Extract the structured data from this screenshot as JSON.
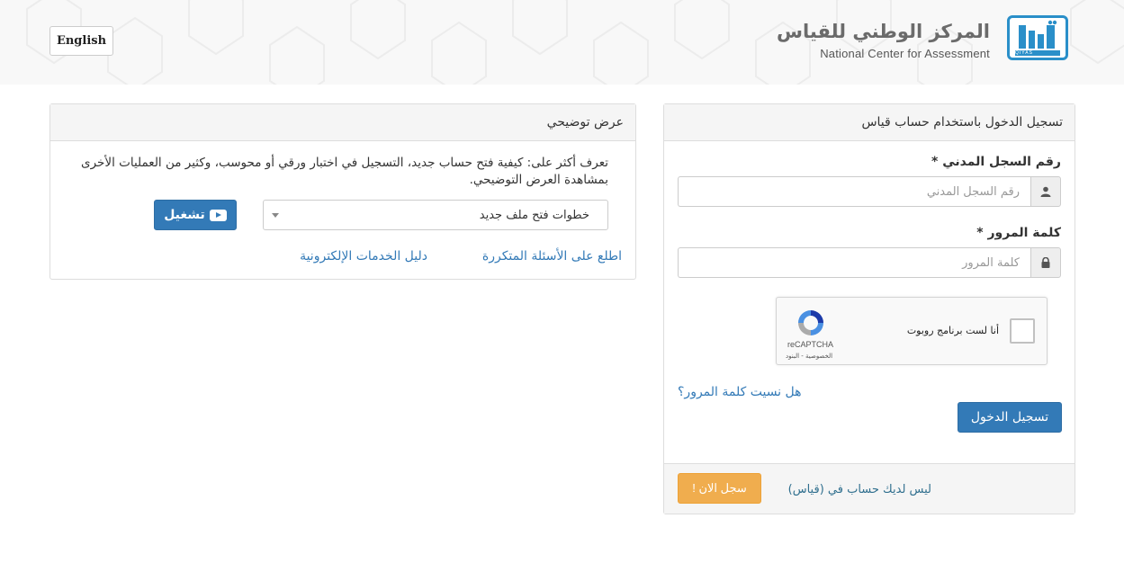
{
  "header": {
    "language_button": "English",
    "logo_title_ar": "المركز الوطني للقياس",
    "logo_title_en": "National Center for Assessment",
    "logo_caption": "QIYAS"
  },
  "login": {
    "heading": "تسجيل الدخول باستخدام حساب قياس",
    "civil_id_label": "رقم السجل المدني *",
    "civil_id_placeholder": "رقم السجل المدني",
    "civil_id_value": "",
    "password_label": "كلمة المرور *",
    "password_placeholder": "كلمة المرور",
    "password_value": "",
    "recaptcha_label": "أنا لست برنامج روبوت",
    "recaptcha_brand": "reCAPTCHA",
    "recaptcha_terms": "الخصوصية - البنود",
    "forgot_password": "هل نسيت كلمة المرور؟",
    "login_button": "تسجيل الدخول",
    "no_account_text": "ليس لديك حساب في (قياس)",
    "register_button": "سجل الان !"
  },
  "demo": {
    "heading": "عرض توضيحي",
    "description": "تعرف أكثر على: كيفية فتح حساب جديد، التسجيل في اختبار ورقي أو محوسب، وكثير من العمليات الأخرى بمشاهدة العرض التوضيحي.",
    "select_value": "خطوات فتح ملف جديد",
    "play_button": "تشغيل",
    "faq_link": "اطلع على الأسئلة المتكررة",
    "guide_link": "دليل الخدمات الإلكترونية"
  },
  "colors": {
    "primary": "#337ab7",
    "warning": "#f0ad4e",
    "logo_blue": "#2a8fc9",
    "header_bg": "#f8f8f8"
  }
}
